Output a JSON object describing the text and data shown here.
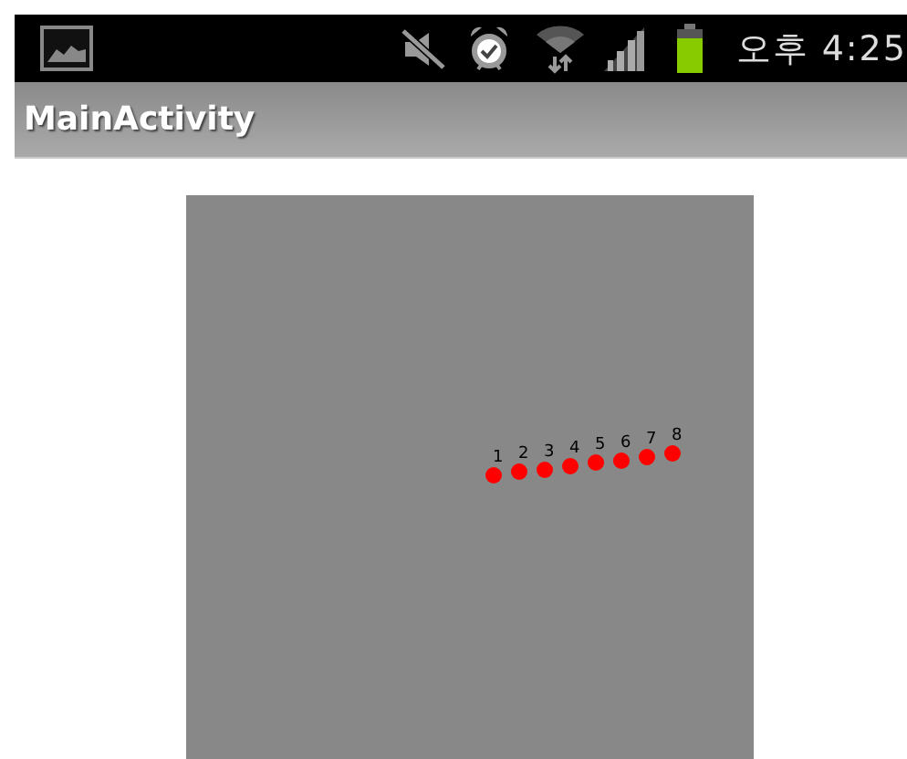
{
  "status_bar": {
    "time": "오후 4:25"
  },
  "title_bar": {
    "title": "MainActivity"
  },
  "canvas": {
    "points": [
      {
        "label": "1"
      },
      {
        "label": "2"
      },
      {
        "label": "3"
      },
      {
        "label": "4"
      },
      {
        "label": "5"
      },
      {
        "label": "6"
      },
      {
        "label": "7"
      },
      {
        "label": "8"
      }
    ]
  }
}
